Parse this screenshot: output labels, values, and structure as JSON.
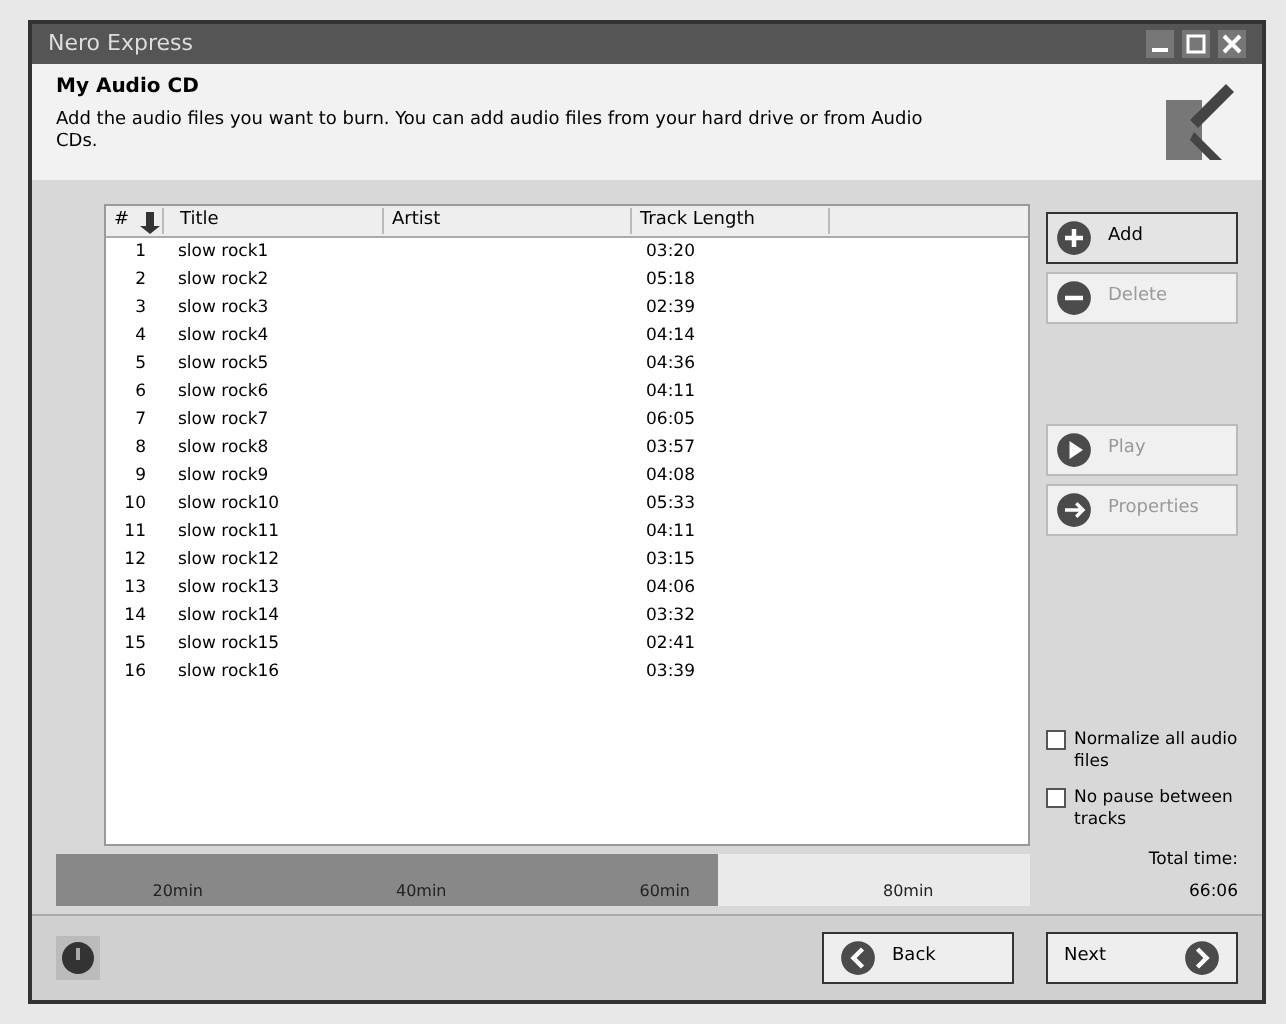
{
  "window": {
    "title": "Nero Express"
  },
  "page": {
    "heading": "My Audio CD",
    "description": "Add the audio files you want to burn. You can add audio files from your hard drive or from Audio CDs."
  },
  "table": {
    "columns": [
      "#",
      "Title",
      "Artist",
      "Track Length"
    ],
    "rows": [
      {
        "number": "1",
        "title": "slow rock1",
        "length": "03:20"
      },
      {
        "number": "2",
        "title": "slow rock2",
        "length": "05:18"
      },
      {
        "number": "3",
        "title": "slow rock3",
        "length": "02:39"
      },
      {
        "number": "4",
        "title": "slow rock4",
        "length": "04:14"
      },
      {
        "number": "5",
        "title": "slow rock5",
        "length": "04:36"
      },
      {
        "number": "6",
        "title": "slow rock6",
        "length": "04:11"
      },
      {
        "number": "7",
        "title": "slow rock7",
        "length": "06:05"
      },
      {
        "number": "8",
        "title": "slow rock8",
        "length": "03:57"
      },
      {
        "number": "9",
        "title": "slow rock9",
        "length": "04:08"
      },
      {
        "number": "10",
        "title": "slow rock10",
        "length": "05:33"
      },
      {
        "number": "11",
        "title": "slow rock11",
        "length": "04:11"
      },
      {
        "number": "12",
        "title": "slow rock12",
        "length": "03:15"
      },
      {
        "number": "13",
        "title": "slow rock13",
        "length": "04:06"
      },
      {
        "number": "14",
        "title": "slow rock14",
        "length": "03:32"
      },
      {
        "number": "15",
        "title": "slow rock15",
        "length": "02:41"
      },
      {
        "number": "16",
        "title": "slow rock16",
        "length": "03:39"
      }
    ]
  },
  "actions": [
    {
      "label": "Add",
      "kind": "add",
      "disabled": false
    },
    {
      "label": "Delete",
      "kind": "delete",
      "disabled": true
    },
    {
      "label": "Play",
      "kind": "play",
      "disabled": true
    },
    {
      "label": "Properties",
      "kind": "properties",
      "disabled": true
    }
  ],
  "options": [
    {
      "label": "Normalize all audio files",
      "checked": false
    },
    {
      "label": "No pause between tracks",
      "checked": false
    }
  ],
  "total": {
    "label": "Total time:",
    "value": "66:06"
  },
  "capacity": {
    "level": 0.68,
    "marks": [
      "20min",
      "40min",
      "60min",
      "80min"
    ]
  },
  "nav": [
    {
      "label": "Back",
      "kind": "back"
    },
    {
      "label": "Next",
      "kind": "next"
    }
  ]
}
